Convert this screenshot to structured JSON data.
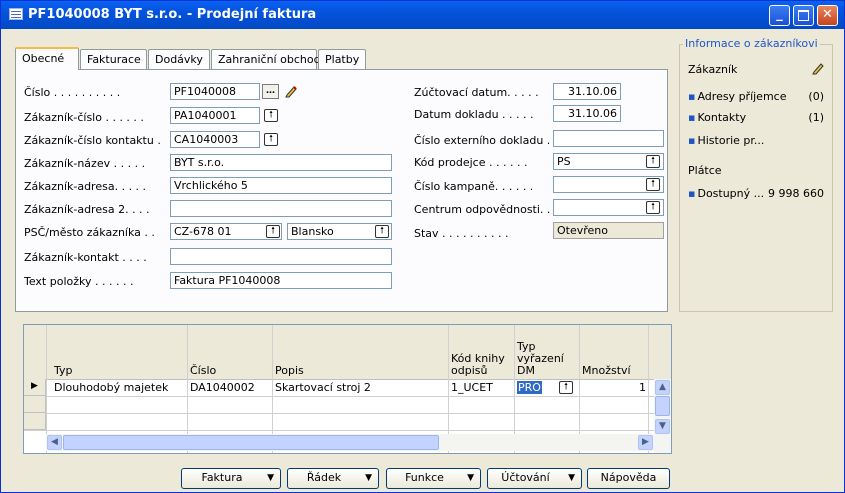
{
  "window": {
    "title": "PF1040008 BYT s.r.o. - Prodejní faktura"
  },
  "tabs": [
    {
      "label": "Obecné"
    },
    {
      "label": "Fakturace"
    },
    {
      "label": "Dodávky"
    },
    {
      "label": "Zahraniční obchod"
    },
    {
      "label": "Platby"
    }
  ],
  "form": {
    "cislo_label": "Číslo . . . . . . . . . .",
    "cislo": "PF1040008",
    "zak_cislo_label": "Zákazník-číslo . . . . . .",
    "zak_cislo": "PA1040001",
    "zak_kontakt_cislo_label": "Zákazník-číslo kontaktu .",
    "zak_kontakt_cislo": "CA1040003",
    "zak_nazev_label": "Zákazník-název . . . . .",
    "zak_nazev": "BYT s.r.o.",
    "zak_adresa_label": "Zákazník-adresa. . . . .",
    "zak_adresa": "Vrchlického 5",
    "zak_adresa2_label": "Zákazník-adresa 2. . . .",
    "zak_adresa2": "",
    "psc_label": "PSČ/město zákazníka . .",
    "psc": "CZ-678 01",
    "mesto": "Blansko",
    "zak_kontakt_label": "Zákazník-kontakt . . . .",
    "zak_kontakt": "",
    "text_polozky_label": "Text položky . . . . . .",
    "text_polozky": "Faktura PF1040008",
    "zuct_datum_label": "Zúčtovací datum. . . . .",
    "zuct_datum": "31.10.06",
    "datum_dokladu_label": "Datum dokladu . . . . .",
    "datum_dokladu": "31.10.06",
    "cislo_ext_label": "Číslo externího dokladu .",
    "cislo_ext": "",
    "kod_prodejce_label": "Kód prodejce . . . . . .",
    "kod_prodejce": "PS",
    "cislo_kampane_label": "Číslo kampaně. . . . . .",
    "cislo_kampane": "",
    "centrum_label": "Centrum odpovědnosti. .",
    "centrum": "",
    "stav_label": "Stav . . . . . . . . . .",
    "stav": "Otevřeno"
  },
  "info": {
    "header": "Informace o zákazníkovi",
    "zakaznik": "Zákazník",
    "adresy": "Adresy příjemce",
    "adresy_count": "(0)",
    "kontakty": "Kontakty",
    "kontakty_count": "(1)",
    "historie": "Historie pr...",
    "platce": "Plátce",
    "dostupny": "Dostupný ...",
    "dostupny_value": "9 998 660"
  },
  "grid": {
    "headers": {
      "typ": "Typ",
      "cislo": "Číslo",
      "popis": "Popis",
      "kod_knihy": "Kód knihy odpisů",
      "typ_vyrazeni": "Typ vyřazení DM",
      "mnozstvi": "Množství"
    },
    "rows": [
      {
        "typ": "Dlouhodobý majetek",
        "cislo": "DA1040002",
        "popis": "Skartovací stroj 2",
        "kod_knihy": "1_UCET",
        "typ_vyrazeni": "PRO",
        "mnozstvi": "1"
      }
    ]
  },
  "buttons": {
    "faktura": "Faktura",
    "radek": "Řádek",
    "funkce": "Funkce",
    "uctovani": "Účtování",
    "napoveda": "Nápověda"
  },
  "colors": {
    "titlebar": "#0453dc",
    "selection": "#316ac5",
    "link": "#2155c5"
  }
}
